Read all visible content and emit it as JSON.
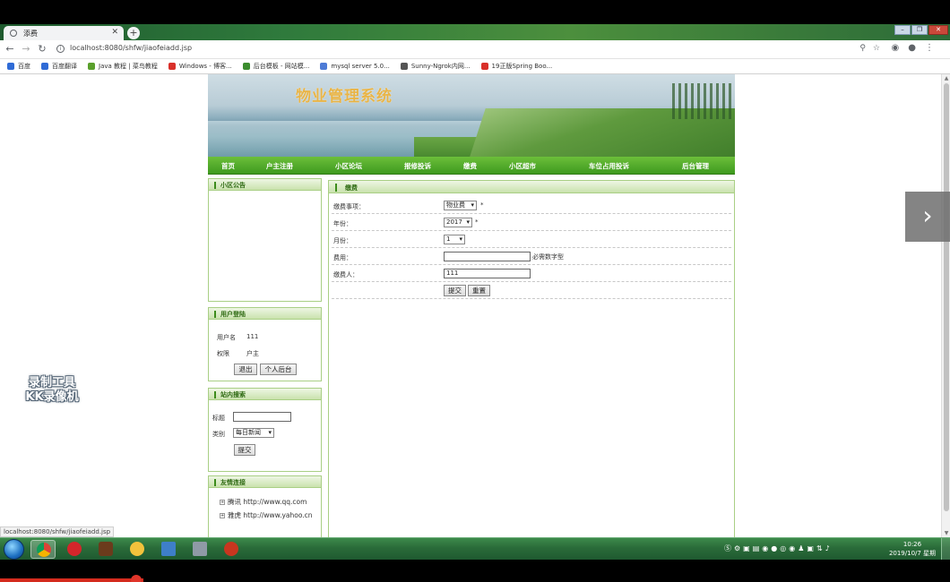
{
  "browser": {
    "tab_title": "添费",
    "url": "localhost:8080/shfw/jiaofeiadd.jsp",
    "bookmarks": [
      {
        "label": "百度",
        "color": "#2f6bd6"
      },
      {
        "label": "百度翻译",
        "color": "#2f6bd6"
      },
      {
        "label": "Java 教程 | 菜鸟教程",
        "color": "#5aa02c"
      },
      {
        "label": "Windows - 博客...",
        "color": "#d9302a"
      },
      {
        "label": "后台模板 - 网站模...",
        "color": "#3c8d2f"
      },
      {
        "label": "mysql server 5.0...",
        "color": "#4d7bd6"
      },
      {
        "label": "Sunny-Ngrok内网...",
        "color": "#555555"
      },
      {
        "label": "19正版Spring Boo...",
        "color": "#d9302a"
      }
    ]
  },
  "site": {
    "title": "物业管理系统",
    "nav": [
      "首页",
      "户主注册",
      "小区论坛",
      "报修投诉",
      "缴费",
      "小区超市",
      "车位占用投诉",
      "后台管理"
    ]
  },
  "sidebar": {
    "notice": {
      "title": "小区公告"
    },
    "login": {
      "title": "用户登陆",
      "username_label": "用户名",
      "username_value": "111",
      "role_label": "权限",
      "role_value": "户主",
      "logout": "退出",
      "personal": "个人后台"
    },
    "search": {
      "title": "站内搜索",
      "title_label": "标题",
      "category_label": "类别",
      "category_value": "每日新闻",
      "submit": "提交"
    },
    "links": {
      "title": "友情连接",
      "items": [
        {
          "name": "腾讯",
          "url": "http://www.qq.com"
        },
        {
          "name": "雅虎",
          "url": "http://www.yahoo.cn"
        }
      ]
    }
  },
  "content": {
    "title": "缴费",
    "fields": {
      "item_label": "缴费事项：",
      "item_value": "物业费",
      "year_label": "年份：",
      "year_value": "2017",
      "month_label": "月份：",
      "month_value": "1",
      "fee_label": "费用：",
      "fee_value": "",
      "fee_hint": "必需数字型",
      "payer_label": "缴费人：",
      "payer_value": "111",
      "required_mark": "*"
    },
    "submit": "提交",
    "reset": "重置"
  },
  "status_url": "localhost:8080/shfw/jiaofeiadd.jsp",
  "watermark": [
    "录制工具",
    "KK录像机"
  ],
  "taskbar": {
    "time": "10:26",
    "date": "2019/10/7 星期一"
  }
}
